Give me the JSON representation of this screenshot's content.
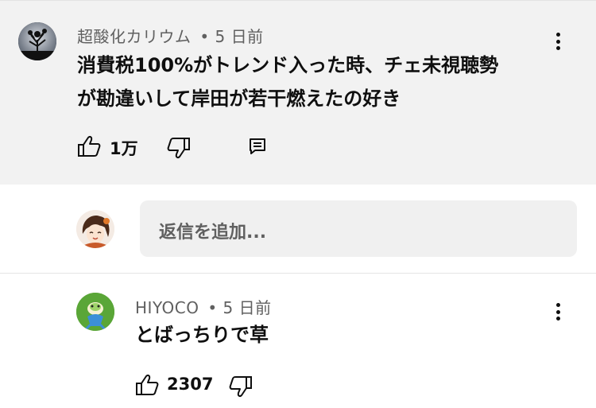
{
  "comments": [
    {
      "author": "超酸化カリウム",
      "time": "• 5 日前",
      "text_line1": "消費税100%がトレンド入った時、チェ未視聴勢",
      "text_line2": "が勘違いして岸田が若干燃えたの好き",
      "likes": "1万",
      "avatar_icon": "tree-avatar-icon"
    },
    {
      "author": "HIYOCO",
      "time": "• 5 日前",
      "text_line1": "とばっちりで草",
      "likes": "2307",
      "avatar_icon": "frog-avatar-icon"
    }
  ],
  "reply": {
    "placeholder": "返信を追加..."
  },
  "colors": {
    "highlight_bg": "#f2f2f2",
    "meta_text": "#606060",
    "text": "#0f0f0f"
  }
}
